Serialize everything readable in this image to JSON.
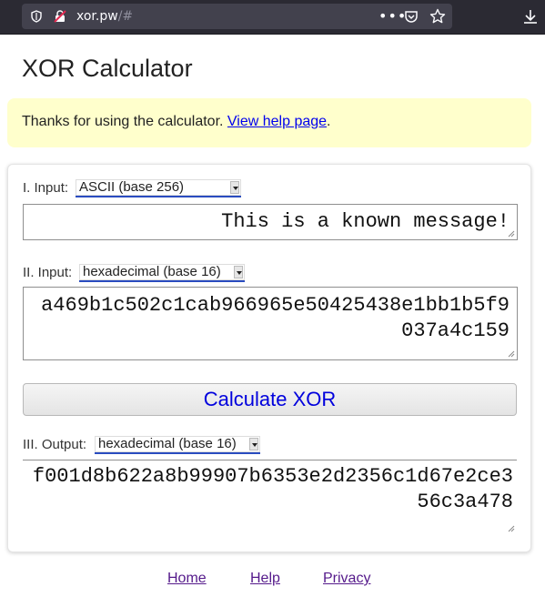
{
  "browser": {
    "url_host": "xor.pw",
    "url_path": "/#"
  },
  "page": {
    "title": "XOR Calculator"
  },
  "notice": {
    "text": "Thanks for using the calculator. ",
    "link": "View help page",
    "suffix": "."
  },
  "input1": {
    "label": "I. Input:",
    "format": "ASCII (base 256)",
    "value": "This is a known message!"
  },
  "input2": {
    "label": "II. Input:",
    "format": "hexadecimal (base 16)",
    "value": "a469b1c502c1cab966965e50425438e1bb1b5f9037a4c159"
  },
  "calculate": {
    "label": "Calculate XOR"
  },
  "output": {
    "label": "III. Output:",
    "format": "hexadecimal (base 16)",
    "value": "f001d8b622a8b99907b6353e2d2356c1d67e2ce356c3a478"
  },
  "footer": {
    "home": "Home",
    "help": "Help",
    "privacy": "Privacy"
  },
  "colors": {
    "notice_bg": "#ffffcc",
    "link": "#0000ee",
    "button_text": "#0000dd",
    "visited_link": "#551a8b"
  }
}
